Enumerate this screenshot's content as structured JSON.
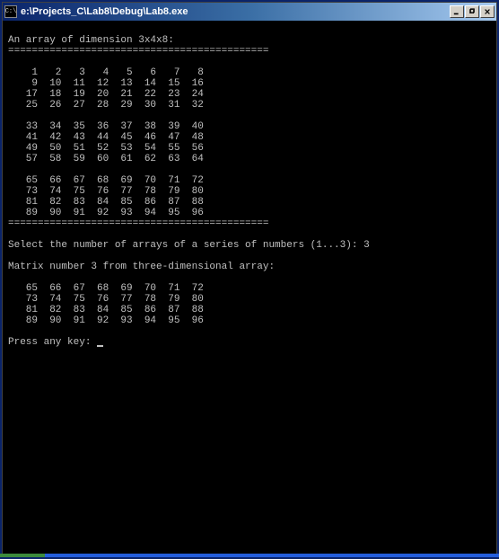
{
  "titlebar": {
    "icon_text": "C:\\",
    "title": "e:\\Projects_C\\Lab8\\Debug\\Lab8.exe"
  },
  "console": {
    "header": "An array of dimension 3x4x8:",
    "divider": "============================================",
    "array3d": [
      [
        [
          1,
          2,
          3,
          4,
          5,
          6,
          7,
          8
        ],
        [
          9,
          10,
          11,
          12,
          13,
          14,
          15,
          16
        ],
        [
          17,
          18,
          19,
          20,
          21,
          22,
          23,
          24
        ],
        [
          25,
          26,
          27,
          28,
          29,
          30,
          31,
          32
        ]
      ],
      [
        [
          33,
          34,
          35,
          36,
          37,
          38,
          39,
          40
        ],
        [
          41,
          42,
          43,
          44,
          45,
          46,
          47,
          48
        ],
        [
          49,
          50,
          51,
          52,
          53,
          54,
          55,
          56
        ],
        [
          57,
          58,
          59,
          60,
          61,
          62,
          63,
          64
        ]
      ],
      [
        [
          65,
          66,
          67,
          68,
          69,
          70,
          71,
          72
        ],
        [
          73,
          74,
          75,
          76,
          77,
          78,
          79,
          80
        ],
        [
          81,
          82,
          83,
          84,
          85,
          86,
          87,
          88
        ],
        [
          89,
          90,
          91,
          92,
          93,
          94,
          95,
          96
        ]
      ]
    ],
    "prompt_select": "Select the number of arrays of a series of numbers (1...3): ",
    "selected_value": "3",
    "matrix_label": "Matrix number 3 from three-dimensional array:",
    "selected_matrix": [
      [
        65,
        66,
        67,
        68,
        69,
        70,
        71,
        72
      ],
      [
        73,
        74,
        75,
        76,
        77,
        78,
        79,
        80
      ],
      [
        81,
        82,
        83,
        84,
        85,
        86,
        87,
        88
      ],
      [
        89,
        90,
        91,
        92,
        93,
        94,
        95,
        96
      ]
    ],
    "press_key": "Press any key: "
  }
}
